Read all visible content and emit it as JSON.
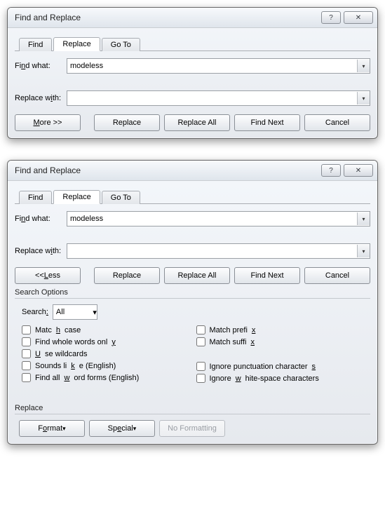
{
  "dialog1": {
    "title": "Find and Replace",
    "tabs": {
      "find": "Find",
      "replace": "Replace",
      "goto": "Go To"
    },
    "findwhat_label": "Find what:",
    "findwhat_value": "modeless",
    "replacewith_label": "Replace with:",
    "replacewith_value": "",
    "btn_more": "More >>",
    "btn_replace": "Replace",
    "btn_replaceall": "Replace All",
    "btn_findnext": "Find Next",
    "btn_cancel": "Cancel"
  },
  "dialog2": {
    "title": "Find and Replace",
    "tabs": {
      "find": "Find",
      "replace": "Replace",
      "goto": "Go To"
    },
    "findwhat_label": "Find what:",
    "findwhat_value": "modeless",
    "replacewith_label": "Replace with:",
    "replacewith_value": "",
    "btn_less": "<< Less",
    "btn_replace": "Replace",
    "btn_replaceall": "Replace All",
    "btn_findnext": "Find Next",
    "btn_cancel": "Cancel",
    "search_options_label": "Search Options",
    "search_label": "Search:",
    "search_value": "All",
    "chk_matchcase": "Match case",
    "chk_wholewords": "Find whole words only",
    "chk_wildcards": "Use wildcards",
    "chk_soundslike": "Sounds like (English)",
    "chk_wordforms": "Find all word forms (English)",
    "chk_matchprefix": "Match prefix",
    "chk_matchsuffix": "Match suffix",
    "chk_ignorepunct": "Ignore punctuation characters",
    "chk_ignorews": "Ignore white-space characters",
    "replace_section_label": "Replace",
    "btn_format": "Format",
    "btn_special": "Special",
    "btn_noformatting": "No Formatting"
  }
}
